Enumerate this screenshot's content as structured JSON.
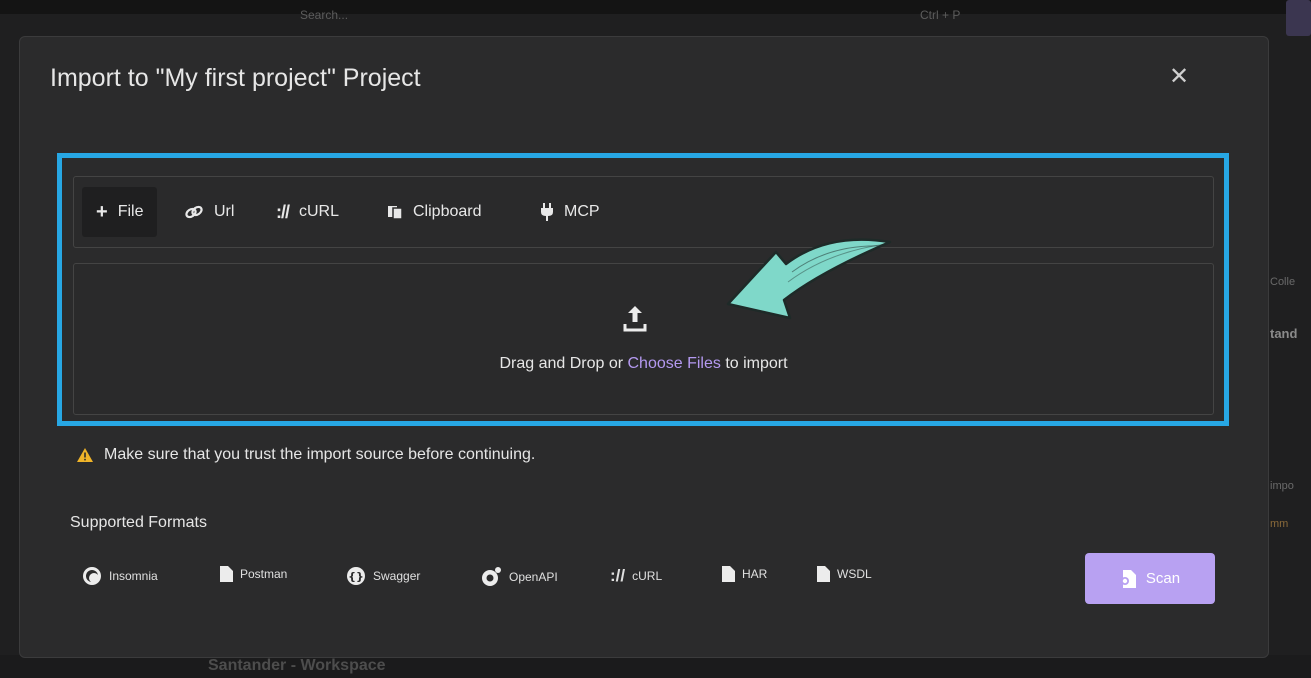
{
  "background": {
    "search_placeholder": "Search...",
    "search_shortcut": "Ctrl + P",
    "right_snippets": [
      "Colle",
      "tand",
      "impo",
      "mm"
    ],
    "workspace_label": "Santander - Workspace"
  },
  "modal": {
    "title": "Import to \"My first project\" Project",
    "close_icon": "close-icon",
    "tabs": [
      {
        "label": "File",
        "icon": "plus-icon",
        "active": true
      },
      {
        "label": "Url",
        "icon": "link-icon",
        "active": false
      },
      {
        "label": "cURL",
        "icon": "curl-icon",
        "active": false
      },
      {
        "label": "Clipboard",
        "icon": "clipboard-icon",
        "active": false
      },
      {
        "label": "MCP",
        "icon": "plug-icon",
        "active": false
      }
    ],
    "dropzone": {
      "text_before": "Drag and Drop or ",
      "link_text": "Choose Files",
      "text_after": " to import"
    },
    "warning": "Make sure that you trust the import source before continuing.",
    "formats_title": "Supported Formats",
    "formats": [
      {
        "label": "Insomnia",
        "icon": "insomnia-icon"
      },
      {
        "label": "Postman",
        "icon": "document-icon"
      },
      {
        "label": "Swagger",
        "icon": "swagger-icon"
      },
      {
        "label": "OpenAPI",
        "icon": "openapi-icon"
      },
      {
        "label": "cURL",
        "icon": "curl-icon"
      },
      {
        "label": "HAR",
        "icon": "document-icon"
      },
      {
        "label": "WSDL",
        "icon": "document-icon"
      }
    ],
    "scan_label": "Scan"
  },
  "colors": {
    "highlight": "#27a7e4",
    "accent": "#b8a1f2",
    "link": "#b499f0",
    "arrow": "#7fd8c9",
    "warning": "#f0b429"
  }
}
